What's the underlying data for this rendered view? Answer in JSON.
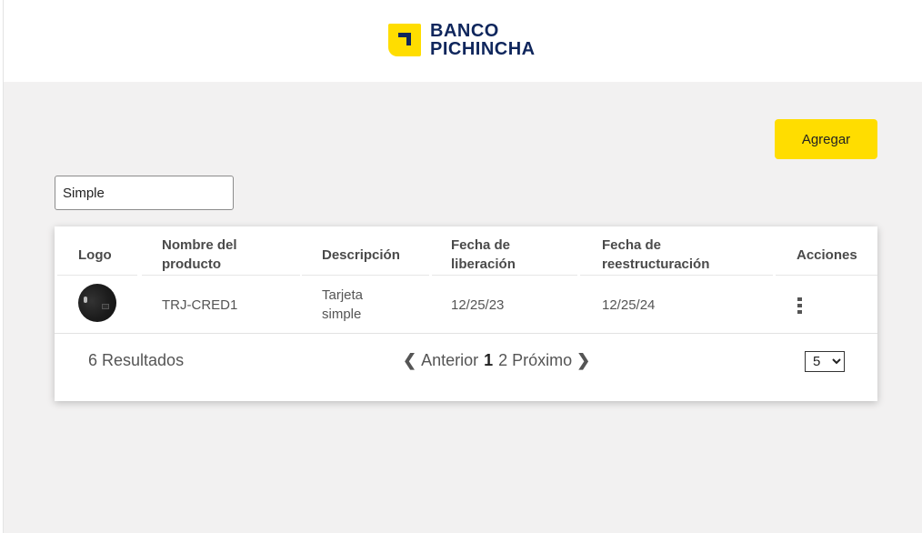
{
  "brand": {
    "line1": "BANCO",
    "line2": "PICHINCHA"
  },
  "actions": {
    "add_label": "Agregar"
  },
  "search": {
    "value": "Simple"
  },
  "table": {
    "headers": {
      "logo": "Logo",
      "name": [
        "Nombre del",
        "producto"
      ],
      "description": "Descripción",
      "release": [
        "Fecha de",
        "liberación"
      ],
      "restructure": [
        "Fecha de",
        "reestructuración"
      ],
      "actions": "Acciones"
    },
    "rows": [
      {
        "logo_icon": "card-image",
        "name": "TRJ-CRED1",
        "description": [
          "Tarjeta",
          "simple"
        ],
        "release_date": "12/25/23",
        "restructure_date": "12/25/24",
        "actions_icon": "kebab-menu-icon"
      }
    ]
  },
  "footer": {
    "results": "6 Resultados",
    "prev_label": "Anterior",
    "next_label": "Próximo",
    "pages": [
      "1",
      "2"
    ],
    "current_page": "1",
    "page_size": "5",
    "page_size_options": [
      "5"
    ]
  },
  "colors": {
    "accent": "#ffdd00",
    "brand_navy": "#0f265c",
    "background": "#f2f1f1"
  }
}
